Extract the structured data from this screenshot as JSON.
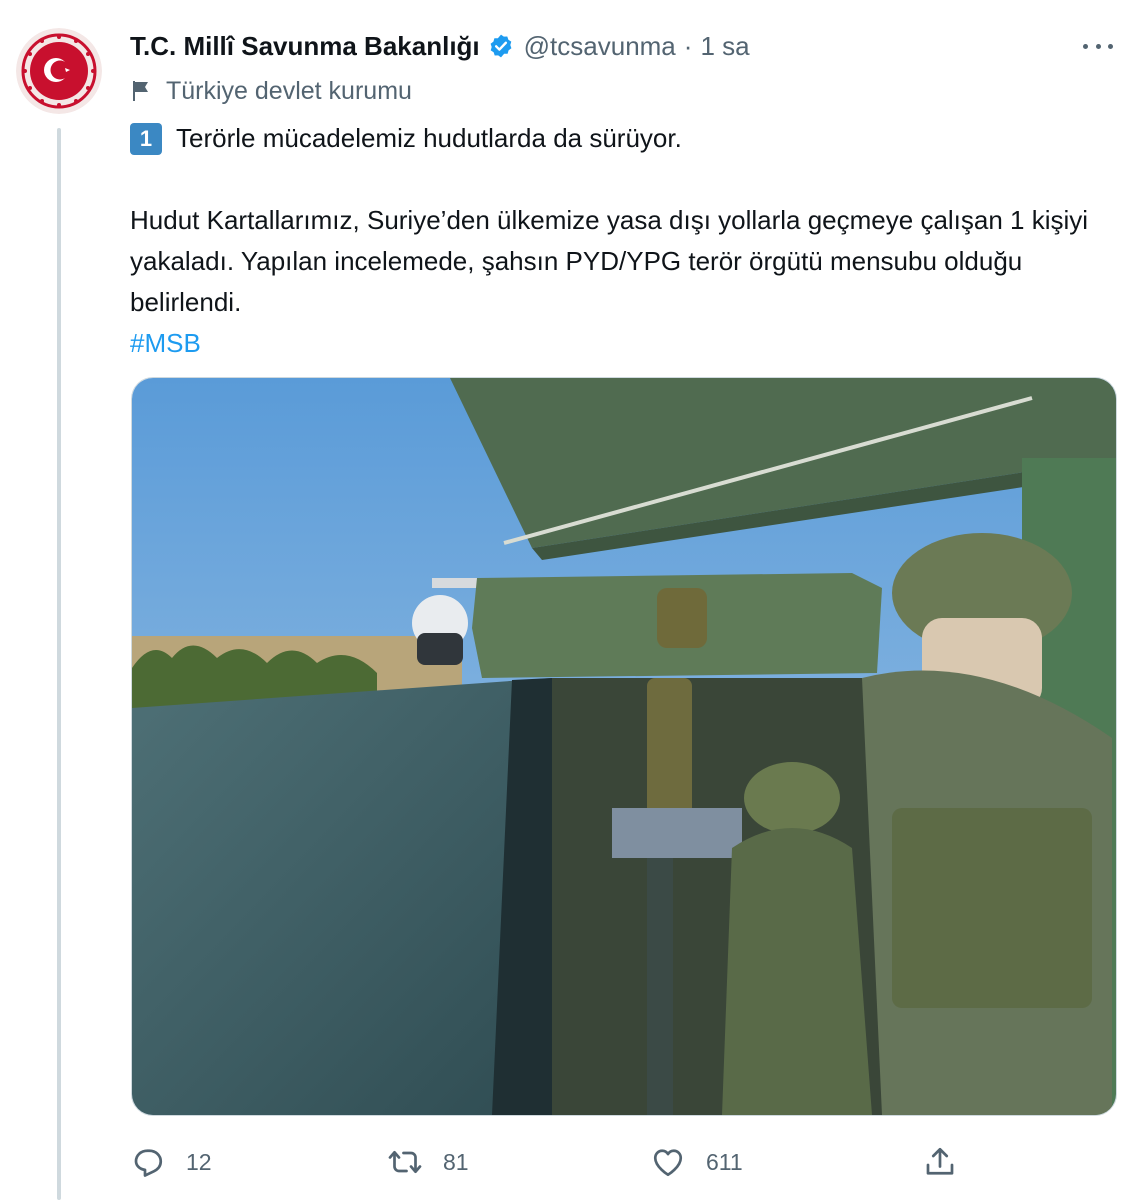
{
  "tweet": {
    "author": {
      "display_name": "T.C. Millî Savunma Bakanlığı",
      "handle": "@tcsavunma",
      "separator": "·",
      "time": "1 sa",
      "label": "Türkiye devlet kurumu",
      "avatar_icon": "ministry-emblem-icon",
      "verified_color": "#1d9bf0"
    },
    "text": {
      "keycap": "1",
      "line1": "Terörle mücadelemiz hudutlarda da sürüyor.",
      "paragraph": "Hudut Kartallarımız, Suriye’den ülkemize yasa dışı yollarla geçmeye çalışan 1 kişiyi yakaladı. Yapılan incelemede, şahsın PYD/YPG terör örgütü mensubu olduğu belirlendi.",
      "hashtag": "#MSB"
    },
    "stats": {
      "replies": "12",
      "retweets": "81",
      "likes": "611"
    },
    "colors": {
      "accent": "#1d9bf0",
      "muted": "#536471",
      "emblem_red": "#c8102e"
    }
  }
}
